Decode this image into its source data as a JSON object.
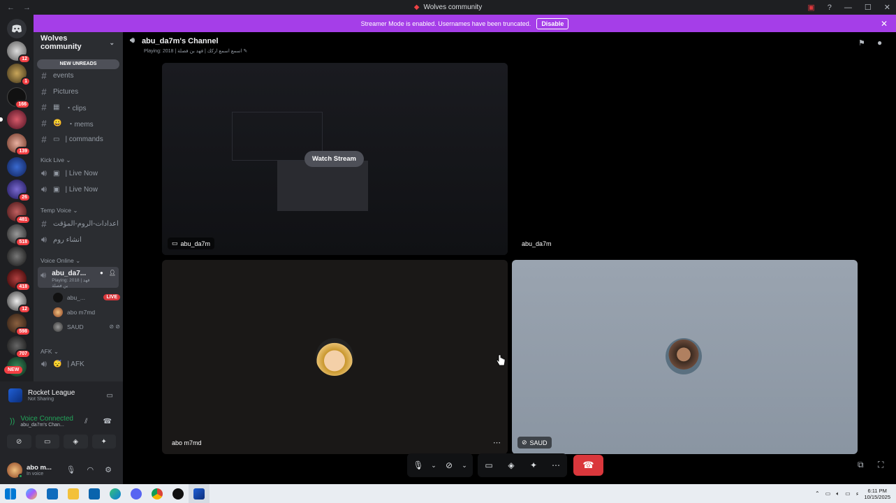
{
  "window": {
    "title": "Wolves community",
    "back": "←",
    "forward": "→"
  },
  "banner": {
    "text": "Streamer Mode is enabled. Usernames have been truncated.",
    "disable_label": "Disable"
  },
  "server_list": {
    "badges": [
      "12",
      "1",
      "166",
      "139",
      "26",
      "481",
      "518",
      "418",
      "12",
      "598",
      "707"
    ],
    "new_label": "NEW"
  },
  "sidebar": {
    "guild_name": "Wolves community",
    "new_unreads": "NEW UNREADS",
    "text_channels": [
      {
        "name": "events"
      },
      {
        "name": "Pictures"
      },
      {
        "name": "・clips",
        "emoji": "▦"
      },
      {
        "name": "・mems",
        "emoji": "😀"
      },
      {
        "name": "| commands",
        "emoji": "▭"
      }
    ],
    "categories": {
      "kick_live": "Kick Live",
      "temp_voice": "Temp Voice",
      "voice_online": "Voice Online",
      "afk": "AFK"
    },
    "kick_live_channels": [
      "| Live Now",
      "| Live Now"
    ],
    "temp_voice_channels": [
      "اعدادات-الروم-المؤقت",
      "انشاء روم"
    ],
    "active_voice": {
      "name": "abu_da7...",
      "status": "Playing: 2018 | فهد بن فصلة"
    },
    "voice_users": [
      {
        "name": "abu_...",
        "live": "LIVE"
      },
      {
        "name": "abo m7md"
      },
      {
        "name": "SAUD"
      }
    ],
    "afk_channel": "| AFK"
  },
  "panel": {
    "activity_title": "Rocket League",
    "activity_sub": "Not Sharing",
    "voice_status": "Voice Connected",
    "voice_channel": "abu_da7m's Chan...",
    "user_name": "abo m...",
    "user_status": "In voice"
  },
  "channel_header": {
    "name": "abu_da7m's Channel",
    "playing": "Playing: 2018 | اسمع اسمع اركك | فهد بن فصلة"
  },
  "tiles": {
    "stream_owner": "abu_da7m",
    "watch_label": "Watch Stream",
    "tile2_name": "abu_da7m",
    "tile3_name": "abo m7md",
    "tile4_name": "SAUD"
  },
  "taskbar": {
    "time": "6:11 PM",
    "date": "10/15/2025"
  }
}
